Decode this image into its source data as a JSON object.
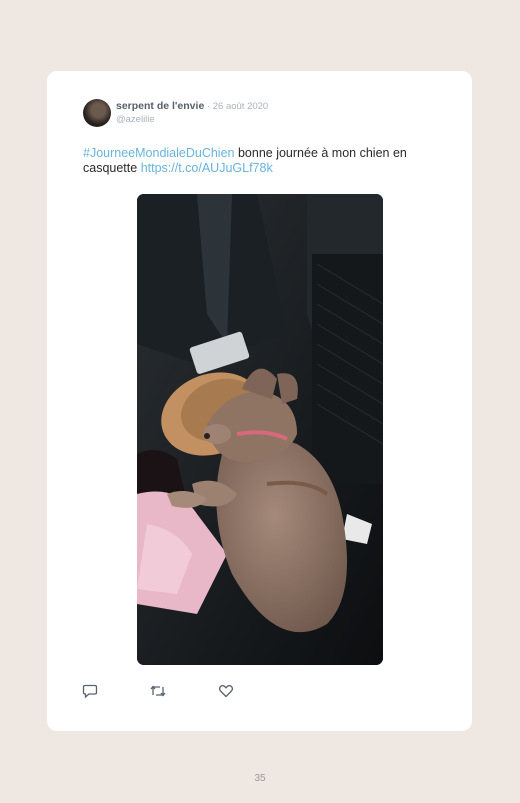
{
  "tweet": {
    "author_name": "serpent de l'envie",
    "separator": " · ",
    "date": "26 août 2020",
    "handle": "@azelilie",
    "hashtag": "#JourneeMondialeDuChien",
    "text_body": " bonne journée à mon chien en casquette ",
    "link": "https://t.co/AUJuGLf78k"
  },
  "actions": {
    "reply_icon": "reply-icon",
    "retweet_icon": "retweet-icon",
    "like_icon": "heart-icon"
  },
  "page": {
    "number": "35"
  },
  "colors": {
    "link": "#67b3dd",
    "background": "#efe7e2",
    "card": "#ffffff"
  }
}
